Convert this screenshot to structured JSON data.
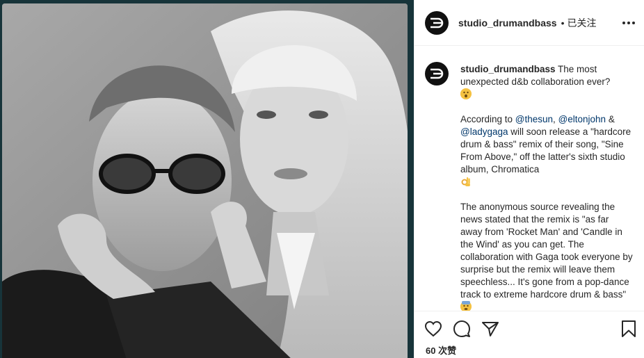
{
  "post": {
    "username": "studio_drumandbass",
    "separator": "•",
    "follow_status": "已关注",
    "likes": "60 次赞"
  },
  "caption": {
    "username": "studio_drumandbass",
    "line1": " The most unexpected d&b collaboration ever?",
    "para2_a": "According to ",
    "mention1": "@thesun",
    "para2_b": ", ",
    "mention2": "@eltonjohn",
    "para2_c": " & ",
    "mention3": "@ladygaga",
    "para2_d": " will soon release a \"hardcore drum & bass\" remix of their song, \"Sine From Above,\" off the latter's sixth studio album, Chromatica",
    "para3": "The anonymous source revealing the news stated that the remix is \"as far away from 'Rocket Man' and 'Candle in the Wind' as you can get. The collaboration with Gaga took everyone by surprise but the remix will leave them speechless... It's gone from a pop-dance track to extreme hardcore drum & bass\""
  },
  "icons": {
    "logo": "db-logo-icon",
    "more": "more-options-icon",
    "like": "heart-icon",
    "comment": "comment-icon",
    "share": "send-icon",
    "save": "bookmark-icon",
    "emoji1": "astonished-face-icon",
    "emoji2": "ok-hand-icon",
    "emoji3": "fearful-face-icon"
  },
  "colors": {
    "mention": "#00376b",
    "text": "#262626",
    "background": "#1e3a40"
  }
}
